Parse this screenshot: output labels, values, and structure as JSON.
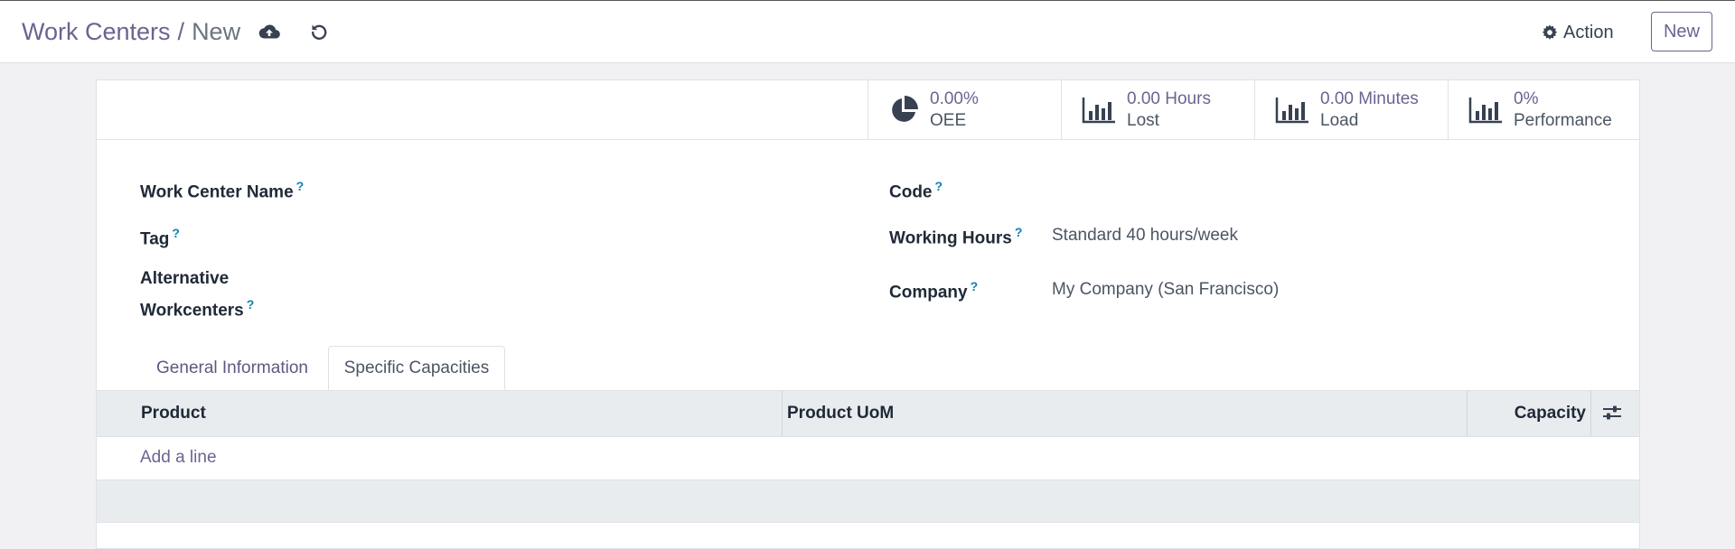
{
  "breadcrumb": {
    "parent": "Work Centers",
    "separator": "/",
    "current": "New"
  },
  "toolbar": {
    "save_icon": "cloud-upload-icon",
    "discard_icon": "undo-icon",
    "action_label": "Action",
    "new_label": "New"
  },
  "stats": [
    {
      "value": "0.00%",
      "label": "OEE",
      "icon": "pie-chart-icon"
    },
    {
      "value": "0.00 Hours",
      "label": "Lost",
      "icon": "bar-chart-icon"
    },
    {
      "value": "0.00 Minutes",
      "label": "Load",
      "icon": "bar-chart-icon"
    },
    {
      "value": "0%",
      "label": "Performance",
      "icon": "bar-chart-icon"
    }
  ],
  "form": {
    "help_marker": "?",
    "name_label": "Work Center Name",
    "tag_label": "Tag",
    "alt_label_line1": "Alternative",
    "alt_label_line2": "Workcenters",
    "code_label": "Code",
    "hours_label": "Working Hours",
    "hours_value": "Standard 40 hours/week",
    "company_label": "Company",
    "company_value": "My Company (San Francisco)"
  },
  "tabs": [
    {
      "label": "General Information",
      "active": false
    },
    {
      "label": "Specific Capacities",
      "active": true
    }
  ],
  "table": {
    "columns": [
      "Product",
      "Product UoM",
      "Capacity"
    ],
    "add_line": "Add a line",
    "settings_icon": "column-settings-icon"
  },
  "colors": {
    "accent": "#6a6491",
    "help": "#0d7fb3",
    "table_header_bg": "#e9ecef"
  }
}
